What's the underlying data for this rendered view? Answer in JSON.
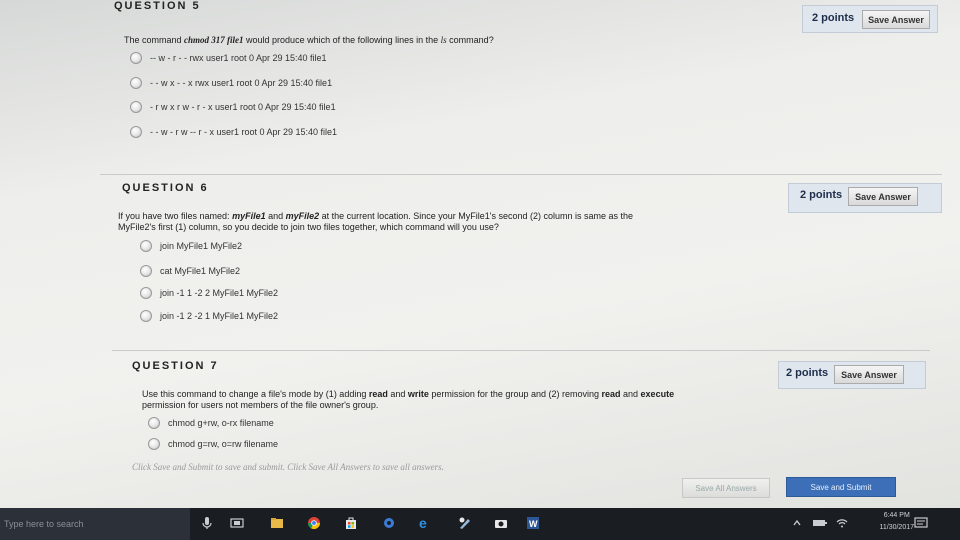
{
  "q5": {
    "title": "QUESTION 5",
    "points": "2 points",
    "save_label": "Save Answer",
    "prompt_pre": "The command ",
    "prompt_cmd": "chmod 317 file1",
    "prompt_mid": " would produce which of the following lines in the ",
    "prompt_ls": "ls",
    "prompt_post": " command?",
    "options": [
      "-- w - r - - rwx user1 root 0 Apr 29 15:40 file1",
      "- - w x - - x rwx user1 root 0 Apr 29 15:40 file1",
      "- r w x r w - r - x user1 root 0 Apr 29 15:40 file1",
      "- - w - r w -- r - x user1 root 0 Apr 29 15:40 file1"
    ]
  },
  "q6": {
    "title": "QUESTION 6",
    "points": "2 points",
    "save_label": "Save Answer",
    "prompt_1": "If you have two files named: ",
    "file_a": "myFile1",
    "prompt_and": " and ",
    "file_b": "myFile2",
    "prompt_2": " at the current location. Since your MyFile1's second (2) column is same as the",
    "prompt_3": "MyFile2's first (1) column, so you decide to join two files together, which command will you use?",
    "options": [
      "join MyFile1 MyFile2",
      "cat MyFile1 MyFile2",
      "join -1 1 -2 2 MyFile1 MyFile2",
      "join -1 2 -2 1 MyFile1 MyFile2"
    ]
  },
  "q7": {
    "title": "QUESTION 7",
    "points": "2 points",
    "save_label": "Save Answer",
    "prompt_1": "Use this command to change a file's mode by (1) adding ",
    "bold_1": "read",
    "prompt_and1": " and ",
    "bold_2": "write",
    "prompt_2": " permission for the group and (2) removing ",
    "bold_3": "read",
    "prompt_and2": " and ",
    "bold_4": "execute",
    "prompt_3": "permission for users not members of the file owner's group.",
    "options": [
      "chmod g+rw, o-rx filename",
      "chmod g=rw, o=rw filename"
    ]
  },
  "footer": {
    "instruction": "Click Save and Submit to save and submit. Click Save All Answers to save all answers.",
    "save_all": "Save All Answers",
    "save_submit": "Save and Submit"
  },
  "taskbar": {
    "search_placeholder": "Type here to search",
    "time": "6:44 PM",
    "date": "11/30/2017"
  },
  "colors": {
    "submit_bg": "#3d6fb8",
    "header_bg": "#dfe6ee"
  }
}
